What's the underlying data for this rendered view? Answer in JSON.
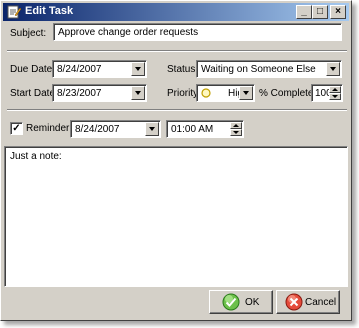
{
  "window": {
    "title": "Edit Task",
    "controls": {
      "minimize": "_",
      "maximize": "□",
      "close": "×"
    }
  },
  "form": {
    "subject_label": "Subject:",
    "subject_value": "Approve change order requests",
    "due_date_label": "Due Date:",
    "due_date_value": "8/24/2007",
    "status_label": "Status:",
    "status_value": "Waiting on Someone Else",
    "start_date_label": "Start Date:",
    "start_date_value": "8/23/2007",
    "priority_label": "Priority:",
    "priority_value": "High",
    "complete_label": "% Complete:",
    "complete_value": "100",
    "reminder_label": "Reminder",
    "reminder_checked_glyph": "✓",
    "reminder_date": "8/24/2007",
    "reminder_time": "01:00 AM",
    "notes": "Just a note:"
  },
  "buttons": {
    "ok": "OK",
    "cancel": "Cancel"
  },
  "icons": {
    "window": "task-icon",
    "priority": "priority-circle-icon",
    "ok": "check-icon",
    "cancel": "cancel-icon"
  },
  "colors": {
    "title_start": "#0a246a",
    "title_end": "#a6caf0",
    "priority_circle": "#f0c800",
    "ok_icon": "#3a9a2a",
    "cancel_icon": "#c8281e",
    "dialog_face": "#d4d0c8"
  }
}
